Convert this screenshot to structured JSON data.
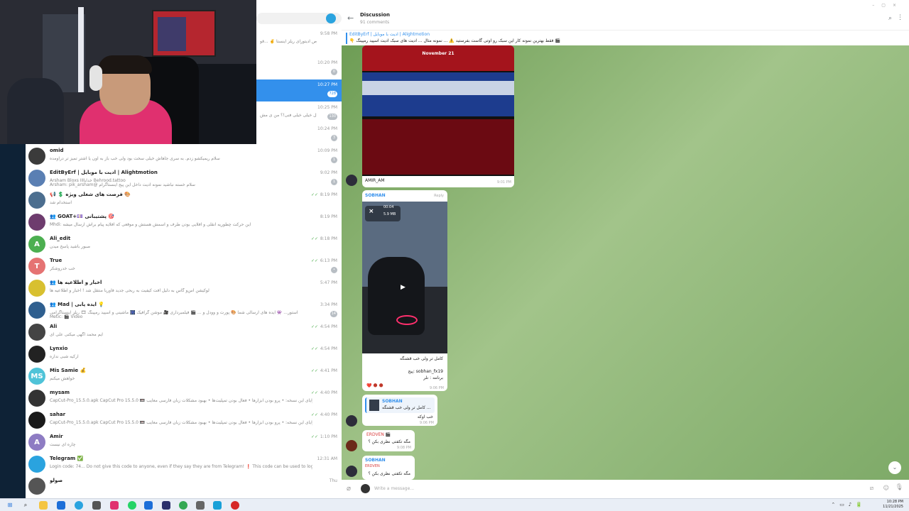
{
  "chat_list": {
    "top_rows": [
      {
        "time": "9:58 PM",
        "preview": "مخصوص ادیتورای ریلز اینستا ✌️ ...قو"
      },
      {
        "time": "10:20 PM",
        "badge": "0"
      },
      {
        "time": "10:27 PM",
        "badge": "728",
        "selected": true
      },
      {
        "time": "10:25 PM",
        "badge": "130",
        "preview": "بچه ها یه سوال خیلی خیلی فنی!؟ من ی مش ..."
      },
      {
        "time": "10:24 PM",
        "badge": "3"
      }
    ],
    "rows": [
      {
        "avatar_color": "#3b3b3b",
        "avatar_text": "",
        "name": "omid",
        "preview": "سلام ریمیکشو زدم. به سری جاهاش خیلی سخت بود ولی خب باز به اون یا اشتر تمیز تر درآومده",
        "time": "10:09 PM",
        "badge": "1"
      },
      {
        "avatar_color": "#5a7fb3",
        "avatar_text": "",
        "name": "EditByErf | ادیت با موبایل | Alightmotion",
        "preview": "Arsham Bloxs خدایاااا Behrood.tattoo",
        "preview2": "Arsham: pik_arsham@ سلام خسته نباشید نمونه ادیت داخل این پیج اینستاگرام",
        "time": "9:02 PM",
        "badge": "1"
      },
      {
        "avatar_color": "#4c6e8f",
        "avatar_text": "",
        "name": "📢 💲 فرصت های شغلی ویژه 🎨",
        "preview": "استخدام شد",
        "time": "8:19 PM",
        "ticks": "✓✓"
      },
      {
        "avatar_color": "#6e3c6e",
        "avatar_text": "",
        "name": "👥 GOAT+💷 پشتیبانی 🎯",
        "preview": "Mhdi: این حرکت چطوریه انقلی و افلایی بودن طرف و اسمش هستش و موقعی که افلایه پیام براش ارسال میشه",
        "time": "8:19 PM"
      },
      {
        "avatar_color": "#4caf50",
        "avatar_text": "A",
        "name": "Ali_edit",
        "preview": "صبور باشید پاسخ میدن",
        "time": "8:18 PM",
        "ticks": "✓✓"
      },
      {
        "avatar_color": "#e57373",
        "avatar_text": "T",
        "name": "True",
        "preview": "خب خدروشکر",
        "time": "6:13 PM",
        "ticks": "✓✓",
        "badge": "•"
      },
      {
        "avatar_color": "#d8c030",
        "avatar_text": "",
        "name": "👥 اخبار و اطلاعیه ها",
        "preview": "لوکیشن اس‌و گاس به دلیل افت کیفیت به ربحی جدید فاوریا منتقل شد ! اخبار و اطلاعیه ها",
        "time": "5:47 PM"
      },
      {
        "avatar_color": "#2f5f8f",
        "avatar_text": "",
        "name": "👥 Mad | ایده پابی 💡",
        "preview": "استور... 👾 ایده های ارسالی شما 🎨 پورت و وودل و ... 🎬 فیلمبرداری 🎥 موشن گرافیک 🎆 ماشینی و اسپید رمپینگ 🎞 ریلز اینستاگرامی",
        "preview2": "Metic: 🎬 Video",
        "time": "3:34 PM",
        "badge": "14"
      },
      {
        "avatar_color": "#444444",
        "avatar_text": "",
        "name": "Ali",
        "preview": "ایم محمد اگهی میکنی علی ای",
        "time": "4:54 PM",
        "ticks": "✓✓"
      },
      {
        "avatar_color": "#222222",
        "avatar_text": "",
        "name": "Lynxio",
        "preview": "ارکیه شبی نداره",
        "time": "4:54 PM",
        "ticks": "✓✓"
      },
      {
        "avatar_color": "#4fc3d8",
        "avatar_text": "MS",
        "name": "Mis Samie 💰",
        "preview": "خواهش میکنم",
        "time": "4:41 PM",
        "ticks": "✓✓"
      },
      {
        "avatar_color": "#333333",
        "avatar_text": "",
        "name": "mysam",
        "preview": "CapCut-Pro_15.5.0.apk CapCut Pro 15.5.0 📼 مزایای این نسخه: • پرو بودن ابزارها • فعال بودن تمپلیت‌ها • بهبود مشکلات زبان فارسی معایب ...",
        "time": "4:40 PM",
        "ticks": "✓✓"
      },
      {
        "avatar_color": "#1a1a1a",
        "avatar_text": "",
        "name": "sahar",
        "preview": "CapCut-Pro_15.5.0.apk CapCut Pro 15.5.0 📼 مزایای این نسخه: • پرو بودن ابزارها • فعال بودن تمپلیت‌ها • بهبود مشکلات زبان فارسی معایب ...",
        "time": "4:40 PM",
        "ticks": "✓✓"
      },
      {
        "avatar_color": "#8e7cc3",
        "avatar_text": "A",
        "name": "Amir",
        "preview": "چاره ای نیست",
        "time": "1:10 PM",
        "ticks": "✓✓"
      },
      {
        "avatar_color": "#2aa3df",
        "avatar_text": "",
        "name": "Telegram ✅",
        "preview": "Login code: 74... Do not give this code to anyone, even if they say they are from Telegram! ❗ This code can be used to log in to your ...",
        "time": "12:31 AM"
      },
      {
        "avatar_color": "#555555",
        "avatar_text": "",
        "name": "صولو",
        "preview": "",
        "time": "Thu"
      }
    ]
  },
  "discussion": {
    "title": "Discussion",
    "subtitle": "91 comments",
    "pinned_title": "EditByErf | ادیت با موبایل | Alightmotion",
    "pinned_text": "👇 فقط بهترین نمونه کار این سبک رو اوتی گاست بفرستید ⚠️ ... نمونه مثال ... ادیت های سبک ادیت اسپید رمپینگ 🎬",
    "media1": {
      "date": "November 21",
      "sender": "AMIR_AM",
      "time": "9:01 PM"
    },
    "media2": {
      "sender": "SOBHAN",
      "reply": "Reply",
      "duration": "00:04",
      "size": "5.9 MB",
      "line1": "کامل تر ولی خب قشنگه",
      "line2": "پیج: sobhan_fx19",
      "line3": "برنامه : نلر",
      "reactions": "❤️ 🌑 🌑",
      "time": "9:06 PM"
    },
    "reply1": {
      "quote_name": "SOBHAN",
      "quote_text": "کامل تر ولی خب قشنگه ...",
      "text": "خب اوکه",
      "time": "9:06 PM"
    },
    "msg3": {
      "sender": "ERDVEN 🎬",
      "text": "مگه تکفتی نظری بکن ؟",
      "time": "9:08 PM"
    },
    "msg4": {
      "sender": "SOBHAN",
      "quote": "ERDVEN",
      "text": "مگه تکفتی نظری بکن ؟"
    },
    "composer_placeholder": "Write a message..."
  },
  "taskbar": {
    "time": "10:28 PM",
    "date": "11/21/2025"
  },
  "colors": {
    "accent": "#3390ec",
    "chat_bg": "#8fb77a",
    "sidebar": "#0e2236"
  }
}
